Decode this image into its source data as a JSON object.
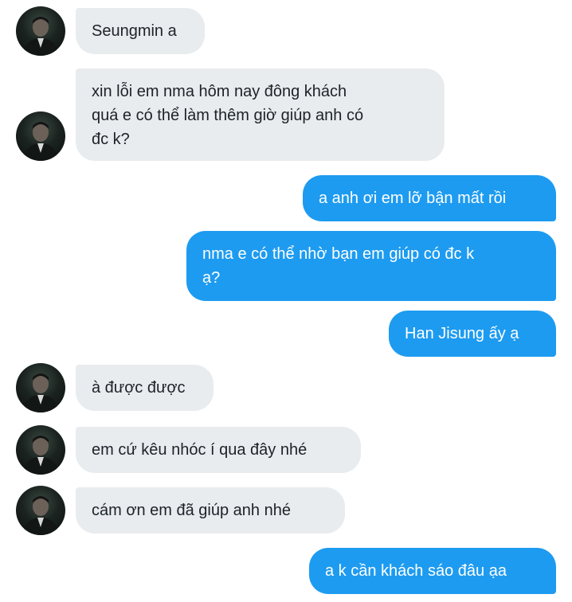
{
  "messages": [
    {
      "side": "incoming",
      "text": "Seungmin a"
    },
    {
      "side": "incoming",
      "text": "xin lỗi em nma hôm nay đông khách\nquá e có thể làm thêm giờ giúp anh có\nđc k?"
    },
    {
      "side": "outgoing",
      "text": "a anh ơi em lỡ bận mất rồi"
    },
    {
      "side": "outgoing",
      "text": "nma e có thể nhờ bạn em giúp có đc k\nạ?"
    },
    {
      "side": "outgoing",
      "text": "Han Jisung ấy ạ"
    },
    {
      "side": "incoming",
      "text": "à được được"
    },
    {
      "side": "incoming",
      "text": "em cứ kêu nhóc í qua đây nhé"
    },
    {
      "side": "incoming",
      "text": "cám ơn em đã giúp anh nhé"
    },
    {
      "side": "outgoing",
      "text": "a k cần khách sáo đâu ạa"
    }
  ],
  "colors": {
    "incoming_bubble": "#e8ecef",
    "outgoing_bubble": "#1d9bf0",
    "incoming_text": "#1c2328",
    "outgoing_text": "#ffffff"
  }
}
